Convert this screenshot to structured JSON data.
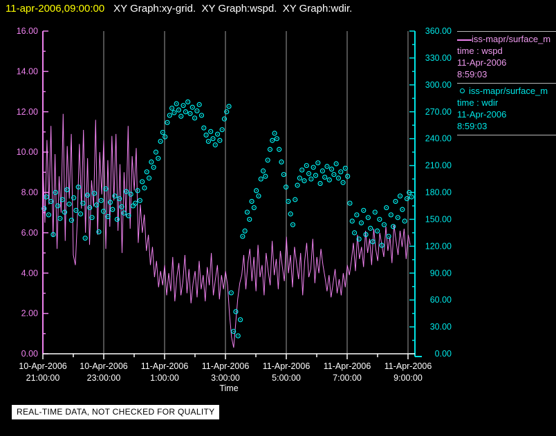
{
  "window": {
    "title_timestamp": "11-apr-2006,09:00:00",
    "title_graphs": "XY Graph:xy-grid.  XY Graph:wspd.  XY Graph:wdir."
  },
  "legend": {
    "entries": [
      {
        "marker": "line-swatch",
        "name": "iss-mapr/surface_m",
        "field": "time : wspd",
        "date": "11-Apr-2006",
        "time": "8:59:03",
        "color": "#ee9aee"
      },
      {
        "marker": "open-circle",
        "name": "iss-mapr/surface_m",
        "field": "time : wdir",
        "date": "11-Apr-2006",
        "time": "8:59:03",
        "color": "#00e6e6"
      }
    ]
  },
  "footer": {
    "banner": "REAL-TIME DATA, NOT CHECKED FOR QUALITY"
  },
  "chart_data": {
    "type": "line+scatter",
    "xlabel": "Time",
    "x_unit_hours_from": "10-Apr-2006 21:00:00",
    "xlim": [
      0,
      12.2
    ],
    "x_major_tick_hours": 2,
    "x_minor_tick_hours": 1,
    "x_tick_labels": [
      {
        "date": "10-Apr-2006",
        "time": "21:00:00"
      },
      {
        "date": "10-Apr-2006",
        "time": "23:00:00"
      },
      {
        "date": "11-Apr-2006",
        "time": "1:00:00"
      },
      {
        "date": "11-Apr-2006",
        "time": "3:00:00"
      },
      {
        "date": "11-Apr-2006",
        "time": "5:00:00"
      },
      {
        "date": "11-Apr-2006",
        "time": "7:00:00"
      },
      {
        "date": "11-Apr-2006",
        "time": "9:00:00"
      }
    ],
    "grid": {
      "vertical": true,
      "horizontal": false,
      "at_hours": [
        2,
        4,
        6,
        8,
        10,
        12
      ],
      "color": "#9e9e9e"
    },
    "left_axis": {
      "field": "wspd",
      "lim": [
        0,
        16
      ],
      "major": 2,
      "minor": 1,
      "color": "#ef82ef",
      "tick_labels": [
        "16.00",
        "14.00",
        "12.00",
        "10.00",
        "8.00",
        "6.00",
        "4.00",
        "2.00",
        "0.00"
      ]
    },
    "right_axis": {
      "field": "wdir",
      "lim": [
        0,
        360
      ],
      "major": 30,
      "minor": 15,
      "color": "#00e6e6",
      "tick_labels": [
        "360.00",
        "330.00",
        "300.00",
        "270.00",
        "240.00",
        "210.00",
        "180.00",
        "150.00",
        "120.00",
        "90.00",
        "60.00",
        "30.00",
        "0.00"
      ]
    },
    "x_axis_color": "#ffffff",
    "series": [
      {
        "name": "wspd",
        "style": "line",
        "color": "#ef82ef",
        "axis": "left",
        "t0": 0,
        "dt": 0.0667,
        "values": [
          9.5,
          6.5,
          10.6,
          7.4,
          11.3,
          5.8,
          9.9,
          5.2,
          8.8,
          7.0,
          11.9,
          5.6,
          10.3,
          7.7,
          10.9,
          4.9,
          4.4,
          6.7,
          10.4,
          7.2,
          11.1,
          6.0,
          9.7,
          5.4,
          8.6,
          7.3,
          11.6,
          5.9,
          10.0,
          7.9,
          10.6,
          5.2,
          9.6,
          6.3,
          10.8,
          7.6,
          10.9,
          6.1,
          9.4,
          5.0,
          9.0,
          6.8,
          11.3,
          6.2,
          9.8,
          8.1,
          10.2,
          5.5,
          7.4,
          6.0,
          6.9,
          5.1,
          5.9,
          4.4,
          5.3,
          3.8,
          4.6,
          3.3,
          4.1,
          3.4,
          4.4,
          2.9,
          4.0,
          3.1,
          4.8,
          2.6,
          3.8,
          4.5,
          2.9,
          3.6,
          4.9,
          3.0,
          4.2,
          2.5,
          3.5,
          4.1,
          2.8,
          4.6,
          3.2,
          3.9,
          2.6,
          4.3,
          3.4,
          5.0,
          2.9,
          3.7,
          4.4,
          2.7,
          3.9,
          3.2,
          4.1,
          3.4,
          1.9,
          0.8,
          0.3,
          1.5,
          2.7,
          3.5,
          3.9,
          4.9,
          3.2,
          4.5,
          5.2,
          3.6,
          4.8,
          3.1,
          5.4,
          3.8,
          4.4,
          2.9,
          5.0,
          4.1,
          3.4,
          5.6,
          3.9,
          4.7,
          3.2,
          5.1,
          4.3,
          3.6,
          5.8,
          4.0,
          4.9,
          3.3,
          5.3,
          4.5,
          3.7,
          5.0,
          2.9,
          4.6,
          5.5,
          3.8,
          4.2,
          5.7,
          3.5,
          4.8,
          4.0,
          5.2,
          4.4,
          3.8,
          3.1,
          3.9,
          2.8,
          3.5,
          4.2,
          3.0,
          3.7,
          2.9,
          4.0,
          3.3,
          4.4,
          3.9,
          4.6,
          5.5,
          4.1,
          5.9,
          4.7,
          5.3,
          4.3,
          6.1,
          5.0,
          5.7,
          4.4,
          6.2,
          5.2,
          4.6,
          6.0,
          5.4,
          4.8,
          6.3,
          5.1,
          5.8,
          4.5,
          6.4,
          5.6,
          4.9,
          6.1,
          5.3,
          6.2,
          4.7,
          5.9,
          5.4
        ]
      },
      {
        "name": "wdir",
        "style": "open-circle",
        "color": "#00f0f0",
        "axis": "right",
        "t0": 0.04,
        "dt": 0.075,
        "values": [
          162,
          175,
          155,
          170,
          133,
          180,
          165,
          151,
          172,
          158,
          183,
          167,
          149,
          174,
          160,
          186,
          156,
          168,
          129,
          177,
          163,
          152,
          179,
          166,
          136,
          171,
          159,
          184,
          153,
          169,
          161,
          176,
          150,
          173,
          164,
          157,
          181,
          154,
          178,
          165,
          168,
          182,
          171,
          192,
          185,
          203,
          196,
          214,
          208,
          225,
          218,
          237,
          247,
          242,
          258,
          266,
          274,
          269,
          279,
          272,
          265,
          277,
          270,
          281,
          268,
          275,
          263,
          271,
          278,
          266,
          252,
          244,
          237,
          248,
          240,
          233,
          245,
          238,
          250,
          262,
          270,
          276,
          68,
          25,
          47,
          20,
          38,
          131,
          137,
          158,
          150,
          170,
          163,
          182,
          176,
          195,
          204,
          198,
          216,
          228,
          238,
          246,
          240,
          228,
          214,
          200,
          186,
          170,
          156,
          144,
          172,
          188,
          196,
          205,
          193,
          210,
          201,
          195,
          208,
          199,
          213,
          190,
          204,
          197,
          209,
          194,
          206,
          200,
          212,
          196,
          203,
          191,
          207,
          198,
          168,
          148,
          135,
          155,
          128,
          146,
          160,
          133,
          152,
          140,
          125,
          158,
          137,
          150,
          121,
          144,
          163,
          131,
          155,
          142,
          170,
          152,
          176,
          161,
          148,
          173,
          180,
          175
        ]
      }
    ]
  }
}
